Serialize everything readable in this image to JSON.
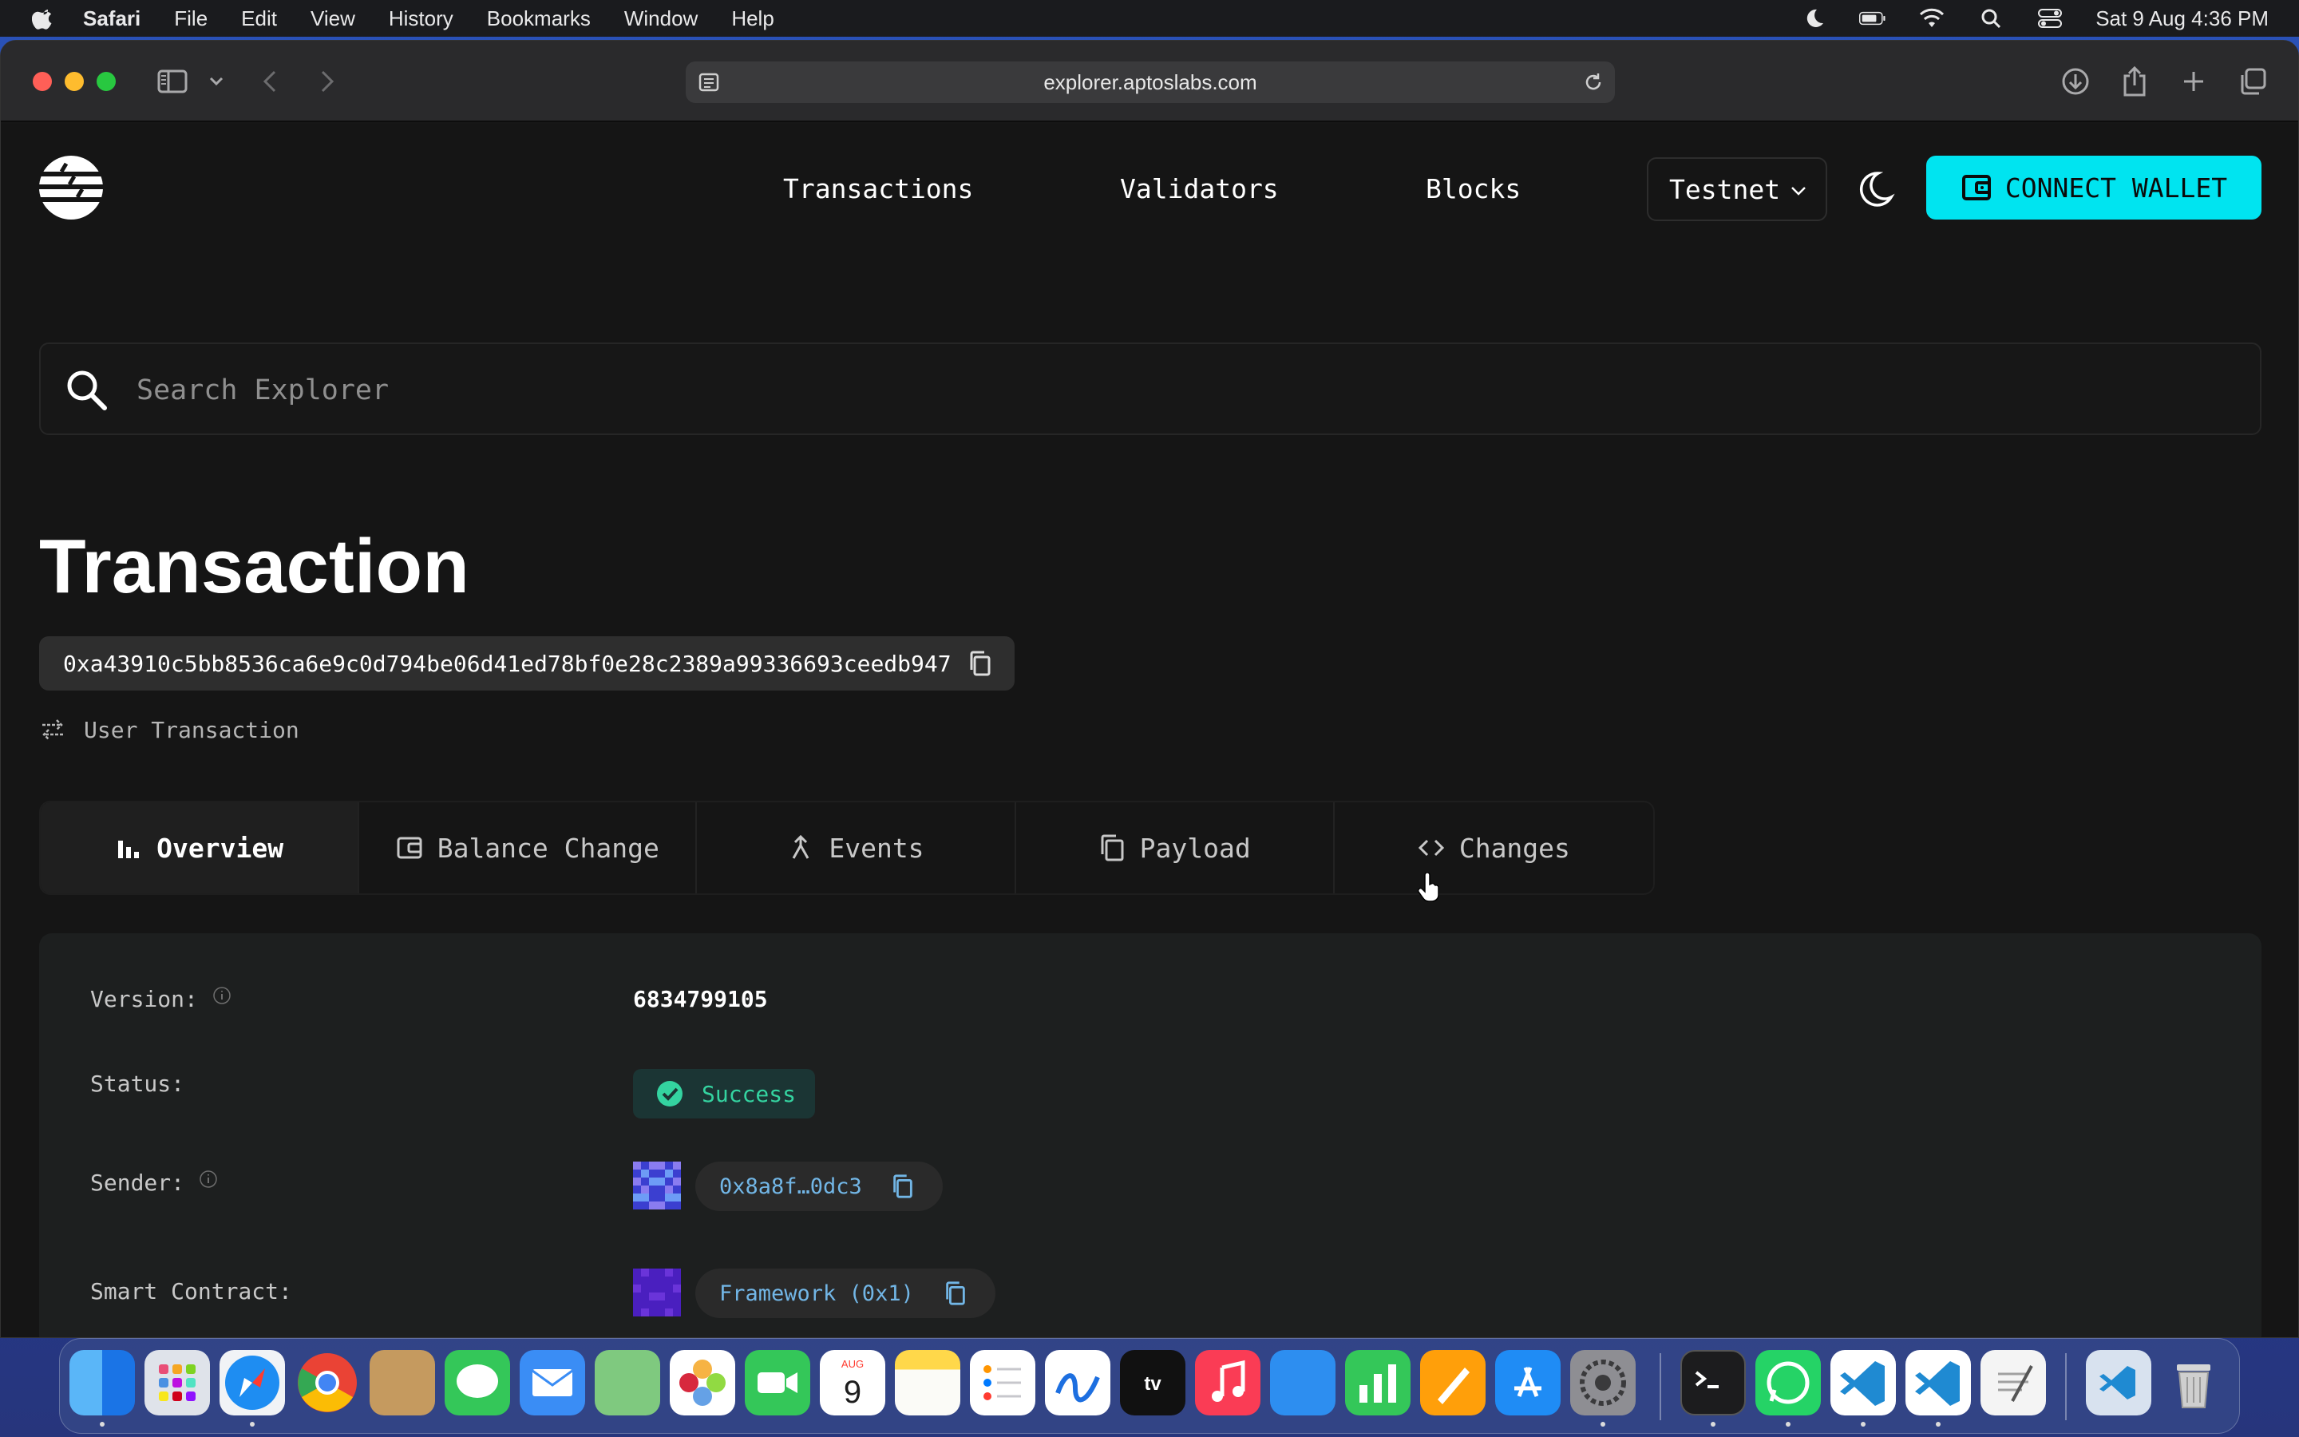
{
  "menubar": {
    "app_name": "Safari",
    "menus": [
      "File",
      "Edit",
      "View",
      "History",
      "Bookmarks",
      "Window",
      "Help"
    ],
    "clock": "Sat 9 Aug  4:36 PM"
  },
  "browser": {
    "url": "explorer.aptoslabs.com"
  },
  "site": {
    "nav": [
      "Transactions",
      "Validators",
      "Blocks"
    ],
    "network": "Testnet",
    "connect_label": "CONNECT WALLET",
    "search_placeholder": "Search Explorer"
  },
  "transaction": {
    "title": "Transaction",
    "hash": "0xa43910c5bb8536ca6e9c0d794be06d41ed78bf0e28c2389a99336693ceedb947",
    "type": "User Transaction",
    "tabs": [
      "Overview",
      "Balance Change",
      "Events",
      "Payload",
      "Changes"
    ],
    "active_tab": "Overview",
    "details": {
      "version_label": "Version:",
      "version_value": "6834799105",
      "status_label": "Status:",
      "status_value": "Success",
      "sender_label": "Sender:",
      "sender_value": "0x8a8f…0dc3",
      "contract_label": "Smart Contract:",
      "contract_value": "Framework (0x1)"
    }
  },
  "colors": {
    "accent": "#00e4f0",
    "success": "#34d3a0",
    "link": "#72b6e6",
    "background": "#151515"
  },
  "dock": {
    "apps": [
      "finder-icon",
      "launchpad-icon",
      "safari-icon",
      "chrome-icon",
      "contacts-icon",
      "messages-icon",
      "mail-icon",
      "maps-icon",
      "photos-icon",
      "facetime-icon",
      "calendar-icon",
      "notes-icon",
      "reminders-icon",
      "freeform-icon",
      "appletv-icon",
      "music-icon",
      "keynote-icon",
      "numbers-icon",
      "pages-icon",
      "appstore-icon",
      "settings-icon",
      "terminal-icon",
      "whatsapp-icon",
      "vscode-icon",
      "vscode-icon",
      "textedit-icon",
      "vscode-folder-icon",
      "trash-icon"
    ],
    "calendar_month": "AUG",
    "calendar_day": "9"
  }
}
